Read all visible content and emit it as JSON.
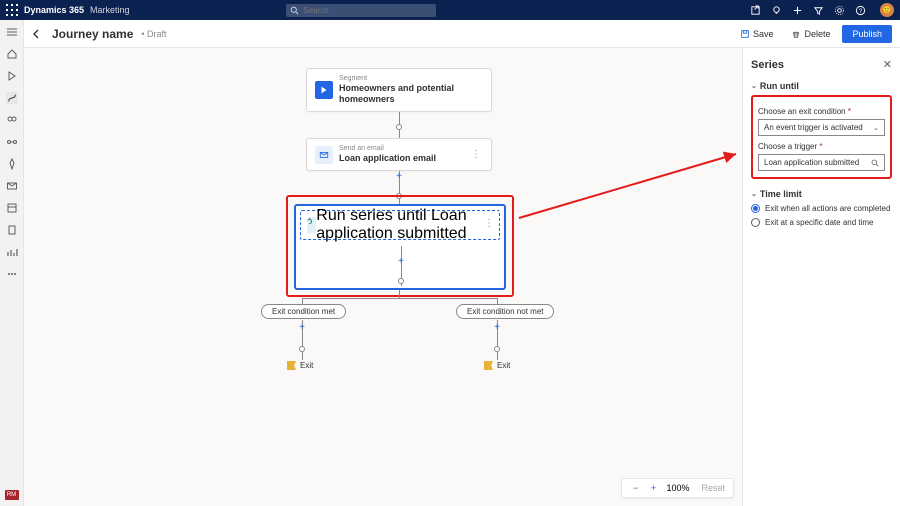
{
  "shell": {
    "brand": "Dynamics 365",
    "area": "Marketing",
    "search_placeholder": "Search"
  },
  "header": {
    "title": "Journey name",
    "status": "• Draft",
    "save": "Save",
    "delete": "Delete",
    "publish": "Publish"
  },
  "rail_badge": "RM",
  "canvas": {
    "segment": {
      "sub": "Segment",
      "main": "Homeowners and potential homeowners"
    },
    "email": {
      "sub": "Send an email",
      "main": "Loan application email"
    },
    "series": {
      "sub": "Run series until",
      "main": "Loan application submitted"
    },
    "exit_met": "Exit condition met",
    "exit_notmet": "Exit condition not met",
    "exit_label": "Exit",
    "zoom": {
      "pct": "100%",
      "reset": "Reset"
    }
  },
  "panel": {
    "title": "Series",
    "run_until": "Run until",
    "exit_condition_label": "Choose an exit condition",
    "exit_condition_value": "An event trigger is activated",
    "trigger_label": "Choose a trigger",
    "trigger_value": "Loan application submitted",
    "time_limit": "Time limit",
    "opt1": "Exit when all actions are completed",
    "opt2": "Exit at a specific date and time"
  }
}
